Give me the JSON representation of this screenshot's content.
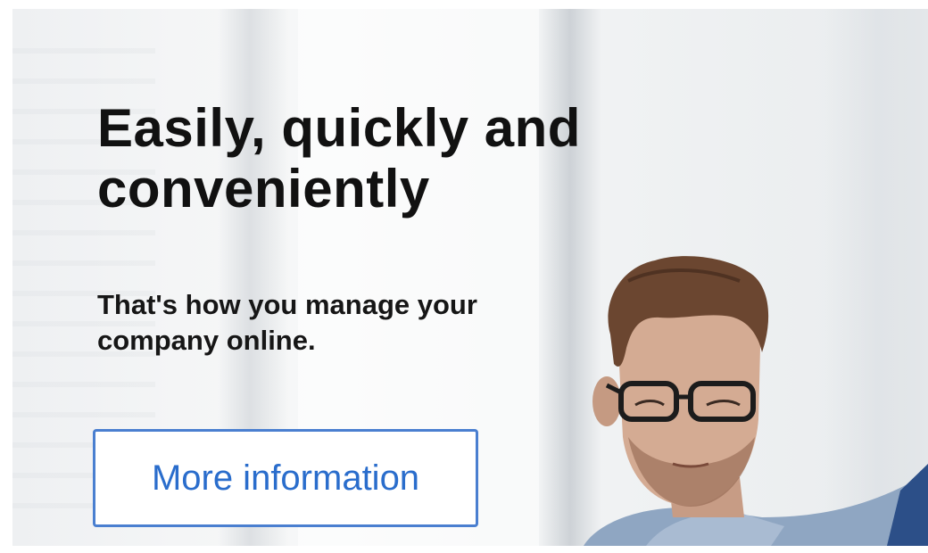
{
  "hero": {
    "headline": "Easily, quickly and conveniently",
    "subline": "That's how you manage your company online.",
    "cta_label": "More information"
  },
  "colors": {
    "cta_border": "#4a7fd0",
    "cta_text": "#2a6dcc",
    "headline_text": "#111111"
  }
}
